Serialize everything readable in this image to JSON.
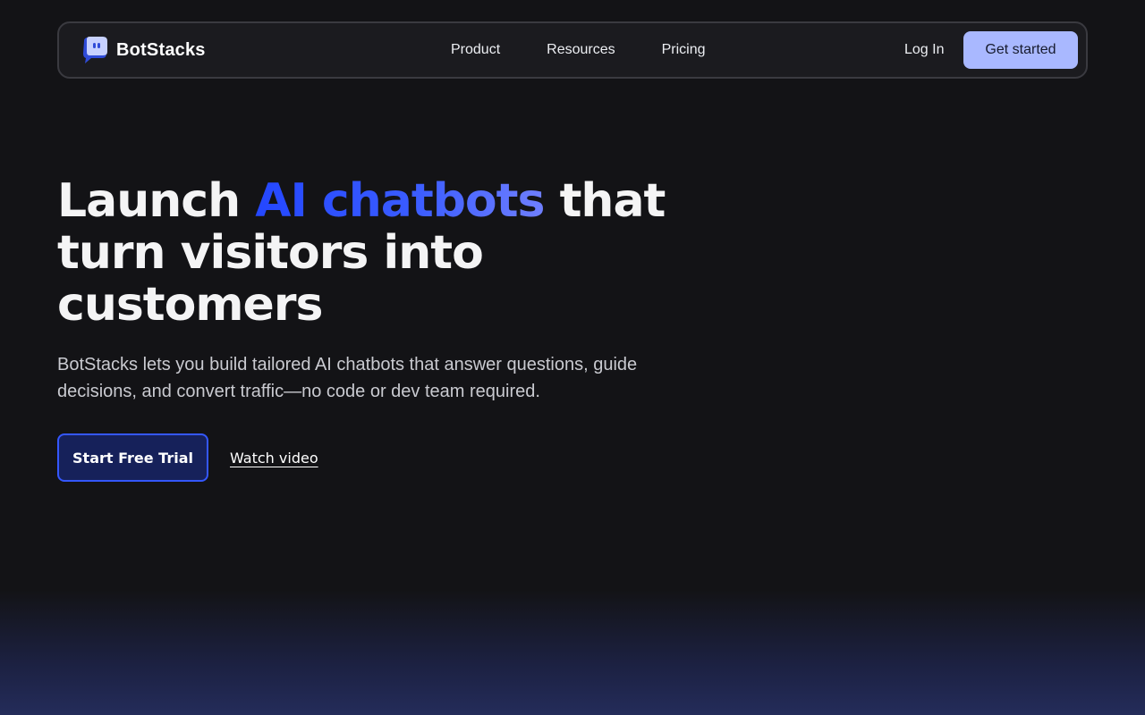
{
  "brand": {
    "name": "BotStacks",
    "icon": "chat-bubble-logo-icon"
  },
  "nav": {
    "links": [
      "Product",
      "Resources",
      "Pricing"
    ],
    "login_label": "Log In",
    "cta_label": "Get started"
  },
  "hero": {
    "title_lead": "Launch ",
    "title_accent": "AI chatbots",
    "title_rest": " that turn visitors into customers",
    "subtitle": "BotStacks lets you build tailored AI chatbots that answer questions, guide decisions, and convert traffic—no code or dev team required.",
    "primary_cta": "Start Free Trial",
    "secondary_cta": "Watch video"
  },
  "colors": {
    "background": "#131316",
    "accent": "#2447ff",
    "button_light": "#a9b8ff",
    "primary_button_bg": "#16215a"
  }
}
